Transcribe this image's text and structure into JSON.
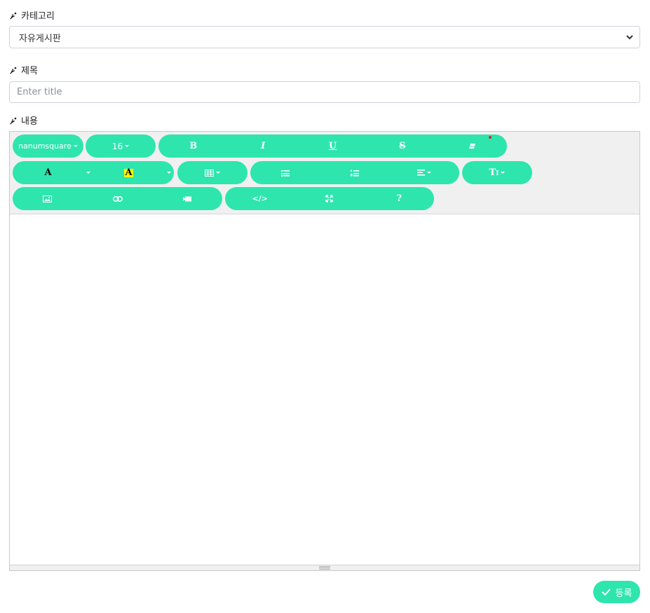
{
  "category": {
    "label": "카테고리",
    "selected": "자유게시판"
  },
  "title": {
    "label": "제목",
    "placeholder": "Enter  title"
  },
  "content": {
    "label": "내용"
  },
  "toolbar": {
    "font_name": "nanumsquare",
    "font_size": "16",
    "bold": "B",
    "italic": "I",
    "underline": "U",
    "strikethrough": "S",
    "fore_color": "A",
    "back_color": "A",
    "style": "T",
    "style_sub": "I",
    "code": "</>",
    "help": "?"
  },
  "submit": {
    "label": "등록"
  },
  "colors": {
    "accent": "#2ee5ae",
    "back_color_highlight": "#ffff00"
  }
}
